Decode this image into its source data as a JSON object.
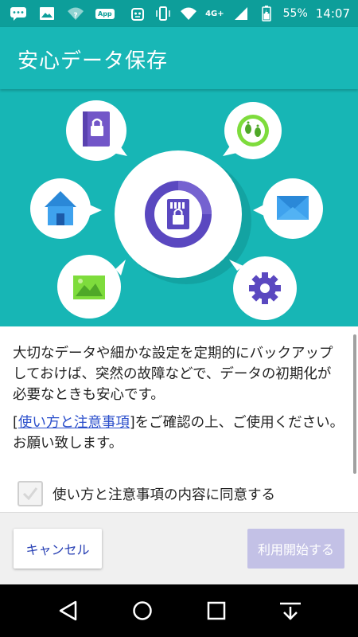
{
  "status_bar": {
    "app_badge": "App",
    "network": "4G+",
    "battery": "55%",
    "time": "14:07",
    "icons": [
      "chat-icon",
      "image-icon",
      "wifi-question-icon",
      "app-badge-icon",
      "robot-icon",
      "vibrate-icon",
      "wifi-icon",
      "signal-icon",
      "battery-icon"
    ]
  },
  "app_bar": {
    "title": "安心データ保存"
  },
  "hero": {
    "center_icon": "sd-card-lock-icon",
    "satellite_icons": [
      "contacts-lock-icon",
      "footprints-icon",
      "home-icon",
      "mail-icon",
      "gallery-icon",
      "settings-gear-icon"
    ],
    "colors": {
      "background": "#17b6b5",
      "ring": "#6a59c8",
      "accent": "#7edc3c"
    }
  },
  "content": {
    "description": "大切なデータや細かな設定を定期的にバックアップしておけば、突然の故障などで、データの初期化が必要なときも安心です。",
    "notice_open_bracket": "[",
    "notice_link": "使い方と注意事項",
    "notice_close_bracket": "]",
    "notice_rest": "をご確認の上、ご使用ください。",
    "notice_line2": "お願い致します。",
    "consent_label": "使い方と注意事項の内容に同意する",
    "consent_checked": false
  },
  "buttons": {
    "cancel": "キャンセル",
    "start": "利用開始する"
  },
  "nav_bar": {
    "icons": [
      "back-icon",
      "home-circle-icon",
      "recents-icon",
      "notification-pull-icon"
    ]
  }
}
